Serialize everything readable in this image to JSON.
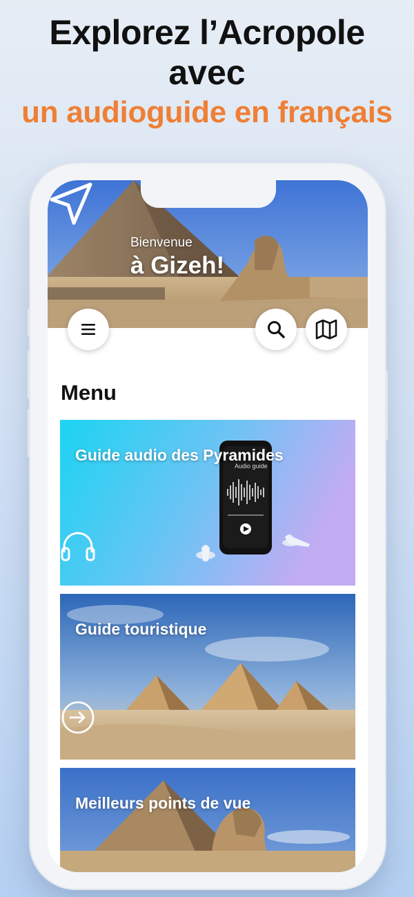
{
  "promo": {
    "line1": "Explorez l’Acropole",
    "line2": "avec",
    "line3": "un audioguide en français"
  },
  "hero": {
    "welcome": "Bienvenue",
    "place": "à Gizeh!"
  },
  "buttons": {
    "menu_icon": "menu-icon",
    "search_icon": "search-icon",
    "map_icon": "map-icon"
  },
  "menu": {
    "title": "Menu",
    "cards": [
      {
        "label": "Guide audio des Pyramides",
        "icon": "headphones-icon",
        "screen_text": "Audio guide"
      },
      {
        "label": "Guide touristique",
        "icon": "arrow-right-circle-icon"
      },
      {
        "label": "Meilleurs points de vue"
      }
    ]
  },
  "colors": {
    "accent": "#ef7f35",
    "title": "#111111",
    "card1_gradient": [
      "#1ed6f2",
      "#b9aaf3"
    ]
  }
}
